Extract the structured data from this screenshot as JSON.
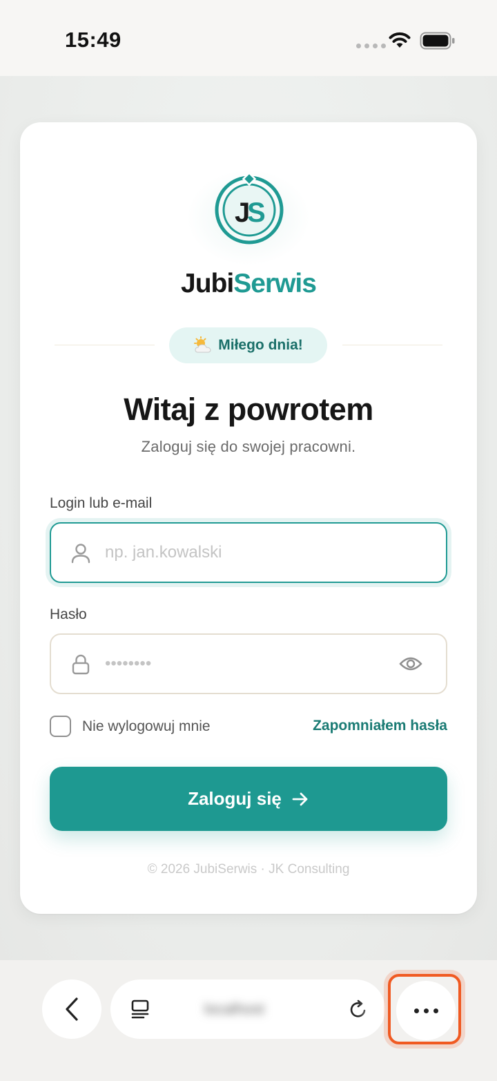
{
  "status_bar": {
    "time": "15:49"
  },
  "brand": {
    "logo_letters": "JS",
    "name_part1": "Jubi",
    "name_part2": "Serwis",
    "primary_color": "#1f9a93"
  },
  "greeting": {
    "icon": "sun-behind-cloud-icon",
    "text": "Miłego dnia!"
  },
  "login_form": {
    "title": "Witaj z powrotem",
    "subtitle": "Zaloguj się do swojej pracowni.",
    "username": {
      "label": "Login lub e-mail",
      "placeholder": "np. jan.kowalski",
      "value": ""
    },
    "password": {
      "label": "Hasło",
      "placeholder": "••••••••",
      "value": ""
    },
    "remember_me_label": "Nie wylogowuj mnie",
    "remember_me_checked": false,
    "forgot_password_label": "Zapomniałem hasła",
    "submit_label": "Zaloguj się",
    "submit_icon": "arrow-right-icon"
  },
  "footer": {
    "text": "© 2026 JubiSerwis · JK Consulting"
  },
  "browser_toolbar": {
    "url": "localhost",
    "highlight_color": "#f05a22"
  }
}
